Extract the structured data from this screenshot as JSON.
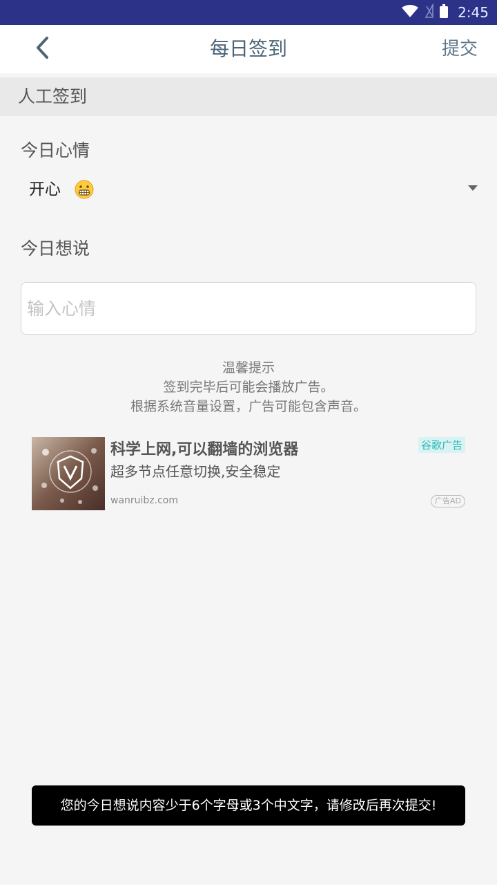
{
  "status_bar": {
    "time": "2:45",
    "icons": [
      "wifi-icon",
      "signal-off-icon",
      "battery-icon"
    ]
  },
  "app_bar": {
    "title": "每日签到",
    "submit_label": "提交",
    "back_icon": "chevron-left-icon"
  },
  "section": {
    "title": "人工签到"
  },
  "mood": {
    "label": "今日心情",
    "selected": "开心",
    "emoji": "grinning-face-icon"
  },
  "comment": {
    "label": "今日想说",
    "value": "",
    "placeholder": "输入心情"
  },
  "tip": {
    "title": "温馨提示",
    "line1": "签到完毕后可能会播放广告。",
    "line2": "根据系统音量设置，广告可能包含声音。"
  },
  "ad": {
    "title": "科学上网,可以翻墙的浏览器",
    "description": "超多节点任意切换,安全稳定",
    "domain": "wanruibz.com",
    "source_badge": "谷歌广告",
    "tag_badge": "广告AD"
  },
  "toast": {
    "message": "您的今日想说内容少于6个字母或3个中文字，请修改后再次提交!"
  },
  "colors": {
    "status_bar": "#2b3288",
    "title": "#4b6478",
    "toast_bg": "#000000",
    "ad_badge": "#2cb7b7"
  }
}
